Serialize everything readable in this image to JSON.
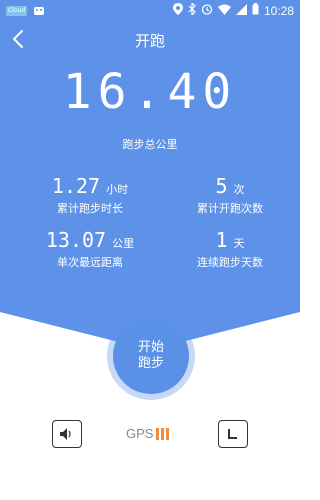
{
  "status_bar": {
    "badge": "Cloud",
    "time": "10:28"
  },
  "nav": {
    "title": "开跑"
  },
  "summary": {
    "total_distance": "16.40",
    "total_distance_label": "跑步总公里"
  },
  "stats": {
    "cumulative_time": {
      "value": "1.27",
      "unit": "小时",
      "label": "累计跑步时长"
    },
    "cumulative_count": {
      "value": "5",
      "unit": "次",
      "label": "累计开跑次数"
    },
    "longest_single": {
      "value": "13.07",
      "unit": "公里",
      "label": "单次最远距离"
    },
    "consecutive_days": {
      "value": "1",
      "unit": "天",
      "label": "连续跑步天数"
    }
  },
  "start_button": {
    "line1": "开始",
    "line2": "跑步"
  },
  "bottom": {
    "gps_label": "GPS"
  },
  "colors": {
    "primary": "#5d92e8",
    "gps_signal": "#f08a3c"
  }
}
